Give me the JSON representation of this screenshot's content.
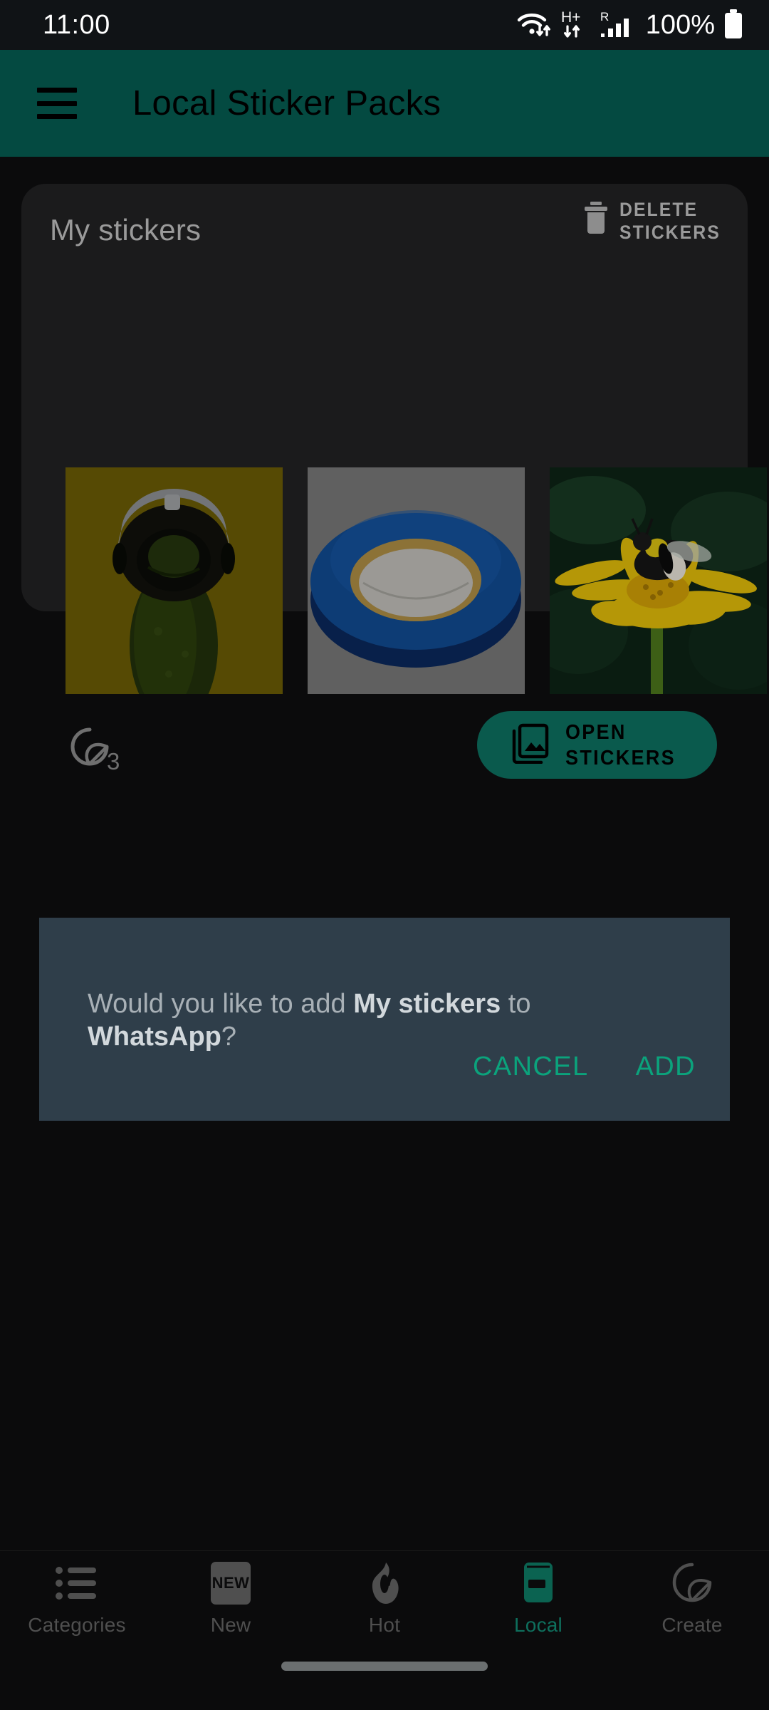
{
  "status_bar": {
    "time": "11:00",
    "battery_text": "100%",
    "network_label": "H+",
    "roaming_label": "R",
    "icons": [
      "wifi-icon",
      "mobile-data-icon",
      "signal-icon",
      "battery-icon"
    ]
  },
  "app_bar": {
    "menu_icon": "hamburger-menu-icon",
    "title": "Local Sticker Packs",
    "background_color": "#044a41"
  },
  "pack_card": {
    "title": "My stickers",
    "delete_label": "DELETE\nSTICKERS",
    "delete_icon": "trash-icon",
    "sticker_count": "3",
    "count_icon": "sticker-icon",
    "open_label": "OPEN\nSTICKERS",
    "open_icon": "photo-library-icon",
    "open_button_color": "#0a5a4d",
    "stickers": [
      {
        "name": "pickle-with-helmet-sticker",
        "alt": "Pickle wearing a helmet on olive yellow background"
      },
      {
        "name": "blue-tape-roll-sticker",
        "alt": "Roll of blue electrical tape on gray background"
      },
      {
        "name": "bee-on-flower-sticker",
        "alt": "Bumblebee on a yellow flower with dark green leaves"
      }
    ]
  },
  "dialog": {
    "message_prefix": "Would you like to add ",
    "pack_name": "My stickers",
    "message_middle": " to ",
    "app_name": "WhatsApp",
    "message_suffix": "?",
    "cancel_label": "CANCEL",
    "add_label": "ADD",
    "background_color": "#2f3e4a",
    "accent_color": "#0ba37c"
  },
  "bottom_nav": {
    "items": [
      {
        "label": "Categories",
        "icon": "list-icon",
        "active": false
      },
      {
        "label": "New",
        "icon": "new-badge-icon",
        "active": false
      },
      {
        "label": "Hot",
        "icon": "flame-icon",
        "active": false
      },
      {
        "label": "Local",
        "icon": "device-storage-icon",
        "active": true
      },
      {
        "label": "Create",
        "icon": "sticker-create-icon",
        "active": false
      }
    ],
    "active_color": "#0e6f5d",
    "inactive_color": "#4f4f4f"
  }
}
